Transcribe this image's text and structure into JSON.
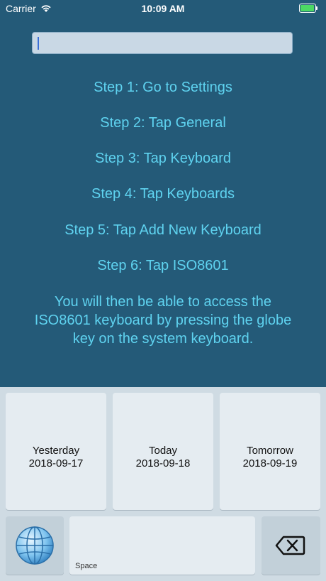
{
  "status_bar": {
    "carrier": "Carrier",
    "time": "10:09 AM",
    "battery_color": "#4cd964"
  },
  "input": {
    "value": ""
  },
  "steps": [
    "Step 1: Go to Settings",
    "Step 2: Tap General",
    "Step 3: Tap Keyboard",
    "Step 4: Tap Keyboards",
    "Step 5: Tap Add New Keyboard",
    "Step 6: Tap ISO8601"
  ],
  "info_text": "You will then be able to access the ISO8601 keyboard by pressing the globe key on the system keyboard.",
  "keyboard": {
    "date_keys": [
      {
        "day": "Yesterday",
        "date": "2018-09-17"
      },
      {
        "day": "Today",
        "date": "2018-09-18"
      },
      {
        "day": "Tomorrow",
        "date": "2018-09-19"
      }
    ],
    "space_label": "Space",
    "globe_icon": "globe-icon",
    "delete_icon": "backspace-icon"
  },
  "colors": {
    "background": "#245a78",
    "step_text": "#5fd3f0",
    "keyboard_bg": "#cfdbe3"
  }
}
